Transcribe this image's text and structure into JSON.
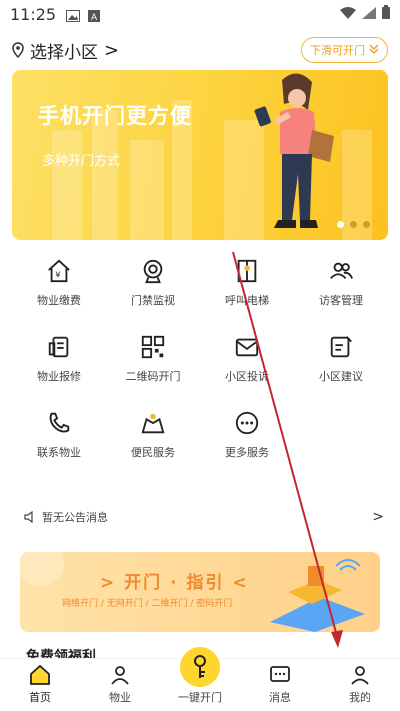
{
  "status_bar": {
    "time": "11:25"
  },
  "header": {
    "location_label": "选择小区",
    "location_chevron": ">",
    "slide_button": "下滑可开门"
  },
  "banner": {
    "title": "手机开门更方便",
    "subtitle": "多种开门方式"
  },
  "services": [
    {
      "label": "物业缴费",
      "icon": "house-yen-icon"
    },
    {
      "label": "门禁监视",
      "icon": "camera-icon"
    },
    {
      "label": "呼叫电梯",
      "icon": "elevator-icon"
    },
    {
      "label": "访客管理",
      "icon": "visitors-icon"
    },
    {
      "label": "物业报修",
      "icon": "repair-doc-icon"
    },
    {
      "label": "二维码开门",
      "icon": "qrcode-icon"
    },
    {
      "label": "小区投诉",
      "icon": "mail-icon"
    },
    {
      "label": "小区建议",
      "icon": "edit-note-icon"
    },
    {
      "label": "联系物业",
      "icon": "phone-icon"
    },
    {
      "label": "便民服务",
      "icon": "map-person-icon"
    },
    {
      "label": "更多服务",
      "icon": "more-icon"
    }
  ],
  "notice": {
    "text": "暂无公告消息",
    "arrow": ">"
  },
  "guide_banner": {
    "title": "> 开门 · 指引 <",
    "subtitle": "网络开门 / 无网开门 / 二维开门 / 密码开门"
  },
  "welfare_title": "免费领福利",
  "nav": [
    {
      "label": "首页",
      "icon": "home-icon"
    },
    {
      "label": "物业",
      "icon": "property-icon"
    },
    {
      "label": "一键开门",
      "icon": "key-icon"
    },
    {
      "label": "消息",
      "icon": "message-icon"
    },
    {
      "label": "我的",
      "icon": "user-icon"
    }
  ],
  "colors": {
    "accent": "#FFD62F",
    "banner": "#FDD23C",
    "guide_text": "#F08A2D",
    "annotation": "#C0282D"
  }
}
